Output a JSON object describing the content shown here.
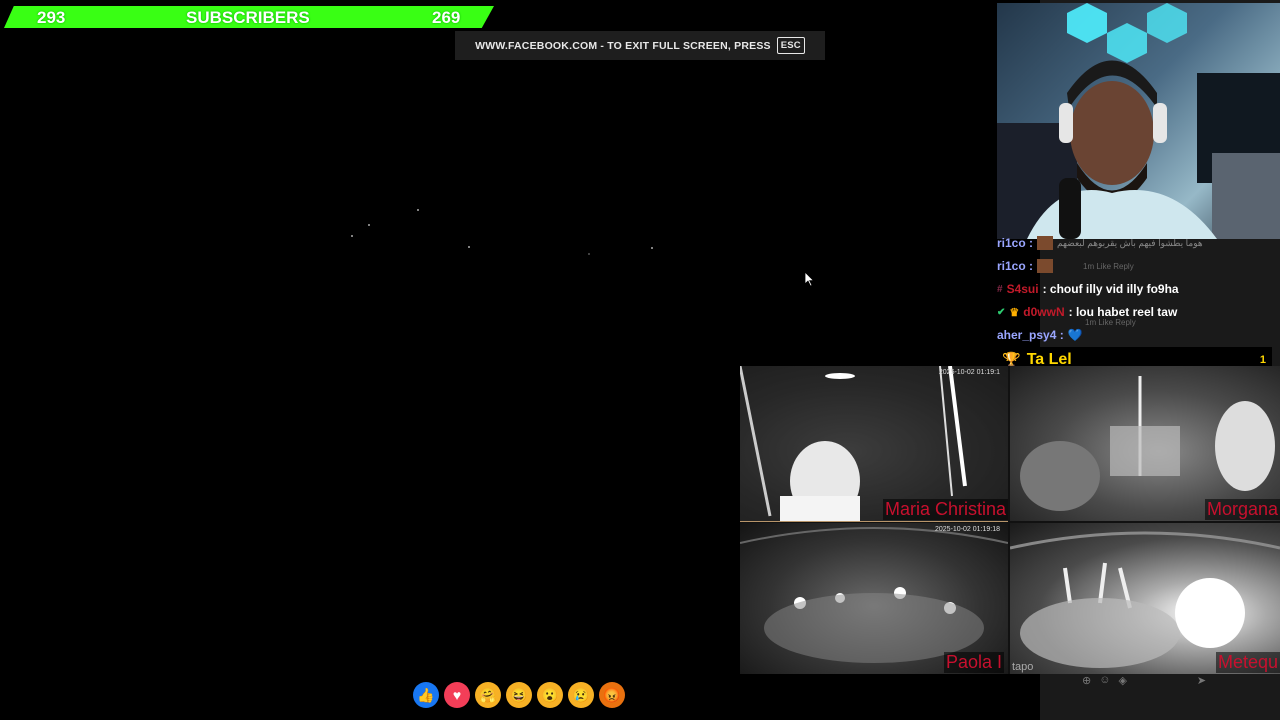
{
  "subscribers": {
    "left_count": "293",
    "label": "SUBSCRIBERS",
    "right_count": "269"
  },
  "fullscreen": {
    "message": "WWW.FACEBOOK.COM - TO EXIT FULL SCREEN, PRESS",
    "key": "ESC"
  },
  "chat": {
    "rows": [
      {
        "user": "ri1co :",
        "text": "",
        "overlay": "هوما يطشوا فيهم باش يقربوهم لبعضهم"
      },
      {
        "user": "ri1co :",
        "text": "",
        "overlay": "1m   Like   Reply"
      },
      {
        "user": "S4sui",
        "text": ": chouf illy vid illy fo9ha"
      },
      {
        "user": "d0wwN",
        "text": ": lou habet reel taw",
        "overlay": "1m   Like   Reply"
      },
      {
        "user": "aher_psy4 :",
        "text": ""
      }
    ]
  },
  "top_bar": {
    "name": "Ta Lel",
    "rank": "1"
  },
  "cameras": [
    {
      "label": "Maria Christina",
      "timestamp": "2025-10-02 01:19:1"
    },
    {
      "label": "Morgana",
      "timestamp": ""
    },
    {
      "label": "Paola I",
      "timestamp": "2025-10-02 01:19:18"
    },
    {
      "label": "Metequ",
      "timestamp": ""
    }
  ],
  "watermark": "tapo",
  "reactions": [
    {
      "name": "like",
      "glyph": "👍",
      "color": "#1877f2"
    },
    {
      "name": "love",
      "glyph": "♥",
      "color": "#f33e58"
    },
    {
      "name": "care",
      "glyph": "🤗",
      "color": "#f7b125"
    },
    {
      "name": "haha",
      "glyph": "😆",
      "color": "#f7b125"
    },
    {
      "name": "wow",
      "glyph": "😮",
      "color": "#f7b125"
    },
    {
      "name": "sad",
      "glyph": "😢",
      "color": "#f7b125"
    },
    {
      "name": "angry",
      "glyph": "😡",
      "color": "#e9710f"
    }
  ],
  "colors": {
    "subscriber_bar": "#39ff14",
    "boat_label": "#c8102e"
  }
}
